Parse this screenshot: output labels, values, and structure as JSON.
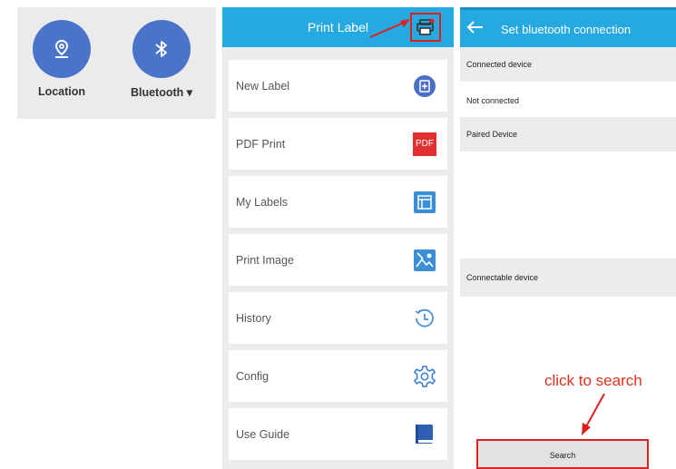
{
  "quick_settings": {
    "tiles": [
      {
        "label": "Location",
        "icon": "location-pin-icon"
      },
      {
        "label": "Bluetooth ▾",
        "icon": "bluetooth-icon"
      }
    ]
  },
  "print_app": {
    "title": "Print Label",
    "header_action_icon": "printer-icon",
    "menu": [
      {
        "label": "New Label",
        "icon": "new-label-icon"
      },
      {
        "label": "PDF Print",
        "icon": "pdf-icon",
        "icon_text": "PDF"
      },
      {
        "label": "My Labels",
        "icon": "my-labels-icon"
      },
      {
        "label": "Print Image",
        "icon": "image-icon"
      },
      {
        "label": "History",
        "icon": "history-icon"
      },
      {
        "label": "Config",
        "icon": "gear-icon"
      },
      {
        "label": "Use Guide",
        "icon": "book-icon"
      }
    ]
  },
  "bluetooth": {
    "title": "Set bluetooth connection",
    "connected_header": "Connected device",
    "connected_status": "Not connected",
    "paired_header": "Paired Device",
    "connectable_header": "Connectable device",
    "search_label": "Search"
  },
  "annotation": {
    "text": "click to search"
  },
  "colors": {
    "header_blue": "#26a8e0",
    "tile_blue": "#4a74c9",
    "highlight_red": "#e02020",
    "pdf_red": "#e03030"
  }
}
